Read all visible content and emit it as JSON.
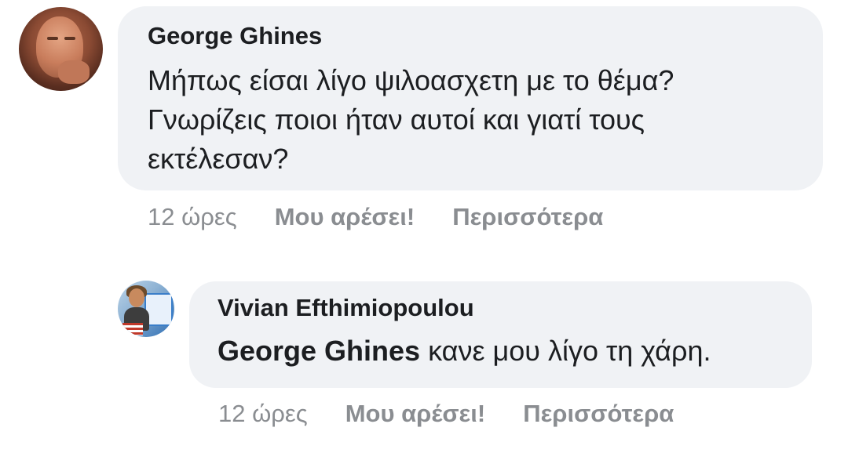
{
  "comments": [
    {
      "author": "George Ghines",
      "text_lines": [
        "Μήπως είσαι λίγο ψιλοασχετη με το θέμα?",
        "Γνωρίζεις ποιοι ήταν αυτοί και γιατί τους",
        "εκτέλεσαν?"
      ],
      "time": "12 ώρες",
      "like_label": "Μου αρέσει!",
      "more_label": "Περισσότερα"
    }
  ],
  "reply": {
    "author": "Vivian Efthimiopoulou",
    "mention": "George Ghines",
    "text": " κανε μου λίγο τη χάρη.",
    "time": "12 ώρες",
    "like_label": "Μου αρέσει!",
    "more_label": "Περισσότερα"
  },
  "colors": {
    "bubble": "#f0f2f5",
    "primary_text": "#1c1e21",
    "secondary_text": "#8a8d91"
  }
}
